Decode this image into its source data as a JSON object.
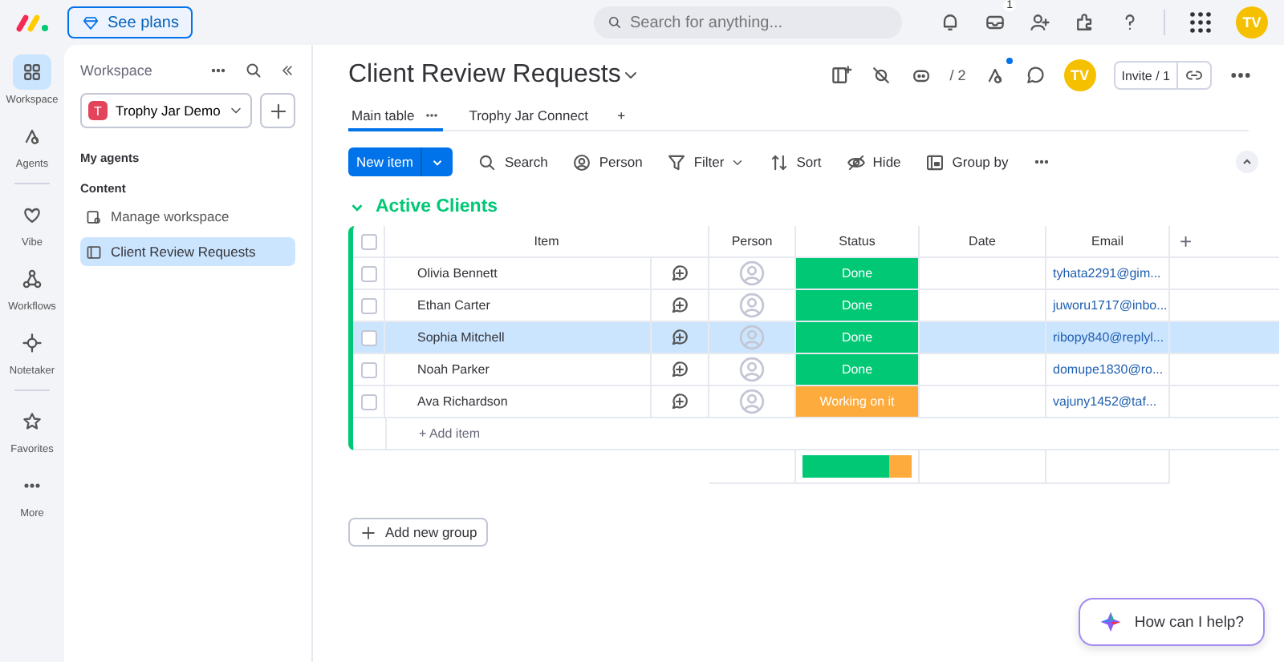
{
  "top_bar": {
    "plans_button": "See plans",
    "search": {
      "placeholder": "Search for anything..."
    },
    "inbox_badge": "1",
    "avatar": "TV"
  },
  "rail": [
    {
      "label": "Workspace",
      "selected": true
    },
    {
      "label": "Agents",
      "selected": false
    },
    {
      "label": "Vibe",
      "selected": false
    },
    {
      "label": "Workflows",
      "selected": false
    },
    {
      "label": "Notetaker",
      "selected": false
    },
    {
      "label": "Favorites",
      "selected": false
    },
    {
      "label": "More",
      "selected": false
    }
  ],
  "workspace_panel": {
    "title": "Workspace",
    "workspace": {
      "initial": "T",
      "name": "Trophy Jar Demo"
    },
    "my_agents": "My agents",
    "content": "Content",
    "items": [
      {
        "label": "Manage workspace",
        "selected": false
      },
      {
        "label": "Client Review Requests",
        "selected": true
      }
    ]
  },
  "board": {
    "title": "Client Review Requests",
    "agents_count": "/ 2",
    "avatar": "TV",
    "invite": "Invite / 1",
    "tabs": [
      {
        "label": "Main table",
        "selected": true
      },
      {
        "label": "Trophy Jar Connect",
        "selected": false
      }
    ],
    "add_tab": "+",
    "toolbar": {
      "new_item": "New item",
      "actions": [
        "Search",
        "Person",
        "Filter",
        "Sort",
        "Hide",
        "Group by"
      ]
    },
    "group": {
      "title": "Active Clients",
      "color": "#00c875",
      "columns": [
        "Item",
        "Person",
        "Status",
        "Date",
        "Email"
      ],
      "add_column": "+",
      "all_checked": false,
      "rows": [
        {
          "item": "Olivia Bennett",
          "status": "Done",
          "color": "#00c875",
          "email": "tyhata2291@gim...",
          "selected": false,
          "checked": false
        },
        {
          "item": "Ethan Carter",
          "status": "Done",
          "color": "#00c875",
          "email": "juworu1717@inbo...",
          "selected": false,
          "checked": false
        },
        {
          "item": "Sophia Mitchell",
          "status": "Done",
          "color": "#00c875",
          "email": "ribopy840@replyl...",
          "selected": true,
          "checked": false
        },
        {
          "item": "Noah Parker",
          "status": "Done",
          "color": "#00c875",
          "email": "domupe1830@ro...",
          "selected": false,
          "checked": false
        },
        {
          "item": "Ava Richardson",
          "status": "Working on it",
          "color": "#fdab3d",
          "email": "vajuny1452@taf...",
          "selected": false,
          "checked": false
        }
      ],
      "add_item": "+ Add item"
    },
    "add_group": "Add new group"
  },
  "assistant": {
    "label": "How can I help?"
  }
}
